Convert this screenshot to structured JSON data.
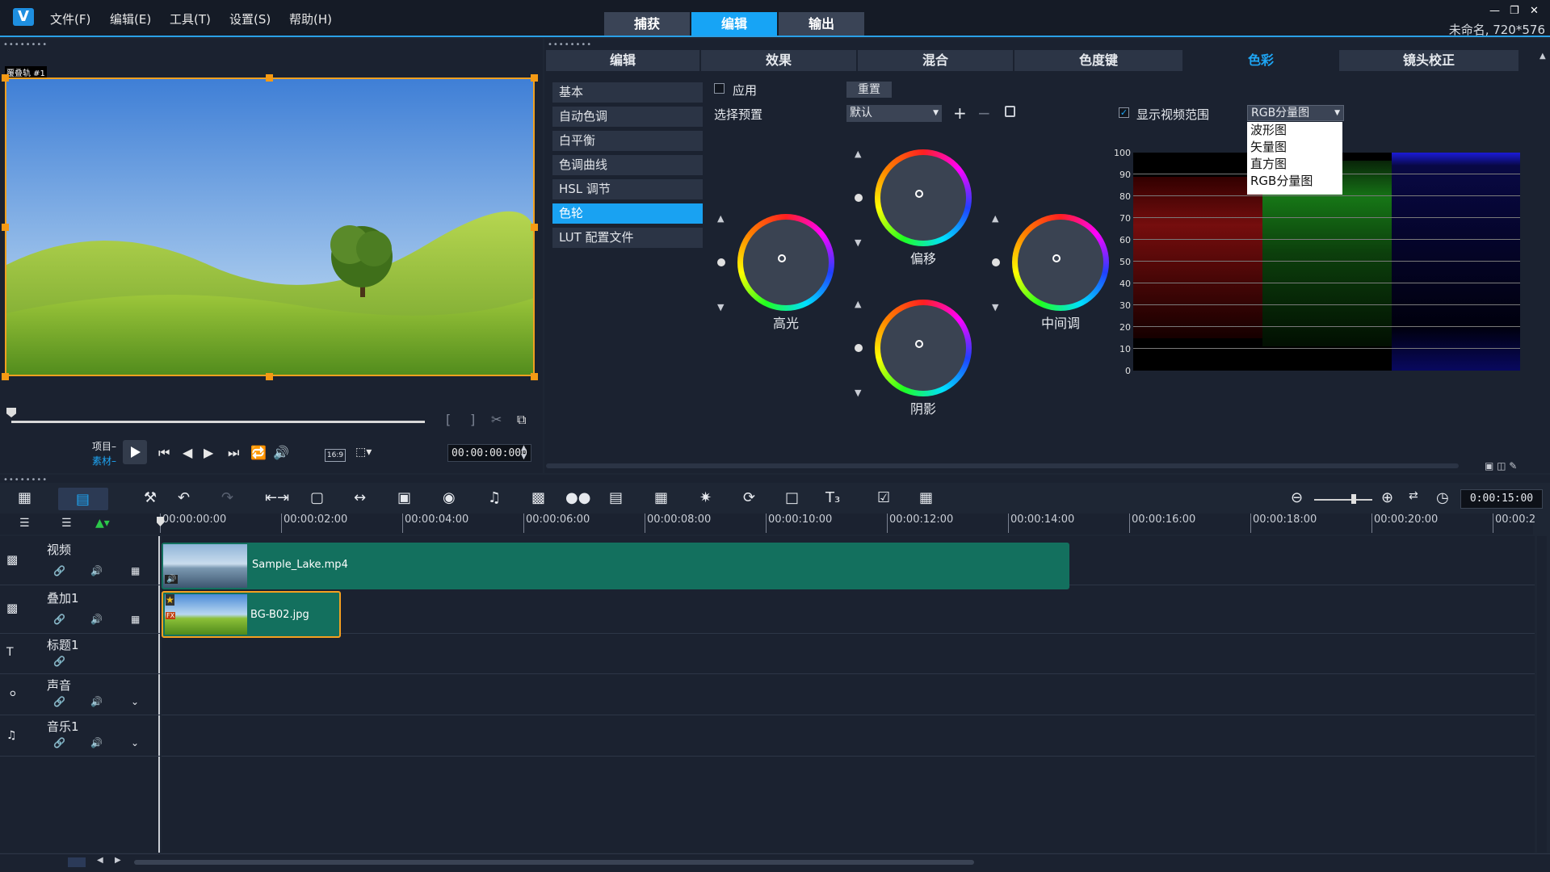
{
  "menu": [
    "文件(F)",
    "编辑(E)",
    "工具(T)",
    "设置(S)",
    "帮助(H)"
  ],
  "modes": [
    {
      "label": "捕获",
      "active": false
    },
    {
      "label": "编辑",
      "active": true
    },
    {
      "label": "输出",
      "active": false
    }
  ],
  "project_info": "未命名, 720*576",
  "preview": {
    "track_label": "覆叠轨 #1",
    "mode_project": "项目",
    "mode_clip": "素材",
    "aspect": "16:9",
    "timecode": "00:00:00:000"
  },
  "panel_tabs": [
    {
      "label": "编辑",
      "active": false
    },
    {
      "label": "效果",
      "active": false
    },
    {
      "label": "混合",
      "active": false
    },
    {
      "label": "色度键",
      "active": false
    },
    {
      "label": "色彩",
      "active": true
    },
    {
      "label": "镜头校正",
      "active": false
    }
  ],
  "color_list": [
    {
      "label": "基本",
      "active": false
    },
    {
      "label": "自动色调",
      "active": false
    },
    {
      "label": "白平衡",
      "active": false
    },
    {
      "label": "色调曲线",
      "active": false
    },
    {
      "label": "HSL 调节",
      "active": false
    },
    {
      "label": "色轮",
      "active": true
    },
    {
      "label": "LUT 配置文件",
      "active": false
    }
  ],
  "color_wheel": {
    "apply_label": "应用",
    "apply_checked": false,
    "reset_label": "重置",
    "preset_label": "选择预置",
    "preset_value": "默认",
    "wheels": {
      "highlight": "高光",
      "offset": "偏移",
      "shadow": "阴影",
      "midtone": "中间调"
    }
  },
  "scope": {
    "show_label": "显示视频范围",
    "show_checked": true,
    "selected": "RGB分量图",
    "options": [
      "波形图",
      "矢量图",
      "直方图",
      "RGB分量图"
    ],
    "yticks": [
      "100",
      "90",
      "80",
      "70",
      "60",
      "50",
      "40",
      "30",
      "20",
      "10",
      "0"
    ]
  },
  "timeline": {
    "timecode": "0:00:15:00",
    "ruler": [
      "00:00:00:00",
      "00:00:02:00",
      "00:00:04:00",
      "00:00:06:00",
      "00:00:08:00",
      "00:00:10:00",
      "00:00:12:00",
      "00:00:14:00",
      "00:00:16:00",
      "00:00:18:00",
      "00:00:20:00",
      "00:00:2"
    ],
    "tracks": [
      {
        "name": "视频",
        "icon": "video-camera-icon"
      },
      {
        "name": "叠加1",
        "icon": "overlay-camera-icon"
      },
      {
        "name": "标题1",
        "icon": "title-text-icon"
      },
      {
        "name": "声音",
        "icon": "voice-microphone-icon"
      },
      {
        "name": "音乐1",
        "icon": "music-note-icon"
      }
    ],
    "clips": {
      "video": "Sample_Lake.mp4",
      "overlay": "BG-B02.jpg",
      "overlay_badge": "FX"
    }
  },
  "colors": {
    "accent": "#17a4f5",
    "clip_video": "#13705e",
    "clip_overlay_border": "#f5a020",
    "panel_bg": "#1b2230"
  }
}
